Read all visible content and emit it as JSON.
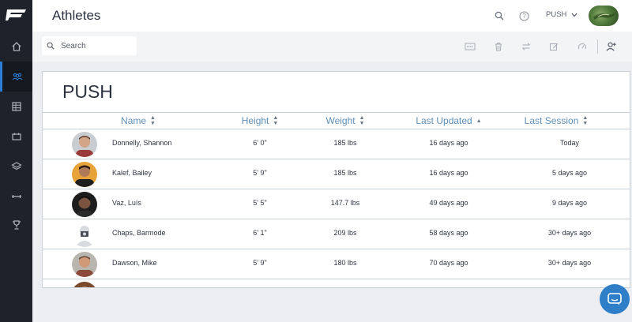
{
  "app": {
    "title": "Athletes"
  },
  "header": {
    "team_selector": "PUSH",
    "icons": [
      "search-icon",
      "help-icon",
      "chevron-down-icon"
    ]
  },
  "sidebar": {
    "items": [
      {
        "icon": "home-icon",
        "active": false
      },
      {
        "icon": "athletes-icon",
        "active": true
      },
      {
        "icon": "table-icon",
        "active": false
      },
      {
        "icon": "calendar-icon",
        "active": false
      },
      {
        "icon": "layers-icon",
        "active": false
      },
      {
        "icon": "dumbbell-icon",
        "active": false
      },
      {
        "icon": "trophy-icon",
        "active": false
      }
    ]
  },
  "toolbar": {
    "search_placeholder": "Search",
    "actions": [
      "csv-icon",
      "trash-icon",
      "transfer-icon",
      "edit-icon",
      "gauge-icon",
      "add-user-icon"
    ]
  },
  "team": {
    "name": "PUSH"
  },
  "table": {
    "columns": [
      {
        "label": "Name",
        "sort": "both"
      },
      {
        "label": "Height",
        "sort": "both"
      },
      {
        "label": "Weight",
        "sort": "both"
      },
      {
        "label": "Last Updated",
        "sort": "up"
      },
      {
        "label": "Last Session",
        "sort": "both"
      }
    ],
    "rows": [
      {
        "name": "Donnelly, Shannon",
        "height": "6' 0\"",
        "weight": "185 lbs",
        "last_updated": "16 days ago",
        "last_session": "Today"
      },
      {
        "name": "Kalef, Bailey",
        "height": "5' 9\"",
        "weight": "185 lbs",
        "last_updated": "16 days ago",
        "last_session": "5 days ago"
      },
      {
        "name": "Vaz, Luís",
        "height": "5' 5\"",
        "weight": "147.7 lbs",
        "last_updated": "49 days ago",
        "last_session": "9 days ago"
      },
      {
        "name": "Chaps, Barmode",
        "height": "6' 1\"",
        "weight": "209 lbs",
        "last_updated": "58 days ago",
        "last_session": "30+ days ago"
      },
      {
        "name": "Dawson, Mike",
        "height": "5' 9\"",
        "weight": "180 lbs",
        "last_updated": "70 days ago",
        "last_session": "30+ days ago"
      }
    ]
  },
  "colors": {
    "sidebar_bg": "#1d222b",
    "accent": "#2b7fd6",
    "header_text": "#5f8fb8",
    "chat_button": "#2f7fc8"
  }
}
